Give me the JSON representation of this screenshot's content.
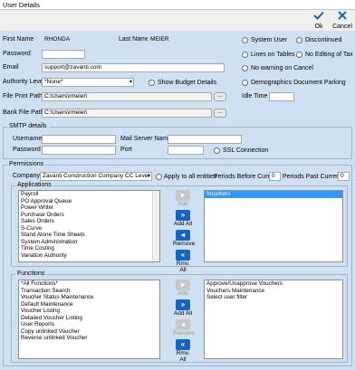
{
  "window": {
    "title": "User Details"
  },
  "toolbar": {
    "ok_label": "Ok",
    "cancel_label": "Cancel"
  },
  "user": {
    "first_name_label": "First Name",
    "first_name": "RHONDA",
    "last_name_label": "Last Name",
    "last_name": "MEIER",
    "password_label": "Password",
    "password": "",
    "email_label": "Email",
    "email": "support@zavanti.com",
    "authority_label": "Authority Level",
    "authority": "*None*",
    "show_budget_label": "Show Budget Details",
    "file_print_label": "File Print Path",
    "file_print_path": "C:\\Users\\rmeier\\",
    "bank_file_label": "Bank File Path",
    "bank_file_path": "C:\\Users\\rmeier\\"
  },
  "options": {
    "system_user": "System User",
    "discontinued": "Discontinued",
    "lines_on_tables": "Lines on Tables",
    "no_editing_tax": "No Editing of Tax",
    "no_warning_cancel": "No warning on Cancel",
    "demographics": "Demographics Document Parking",
    "idle_time_label": "Idle Time",
    "idle_time": ""
  },
  "smtp": {
    "title": "SMTP details",
    "username_label": "Username",
    "username": "",
    "mail_server_label": "Mail Server Name",
    "mail_server": "",
    "password_label": "Password",
    "password": "",
    "port_label": "Port",
    "port": "",
    "ssl_label": "SSL Connection"
  },
  "permissions": {
    "title": "Permissions",
    "company_label": "Company",
    "company": "Zavanti Construction Company CC Level",
    "apply_all_label": "Apply to all entities",
    "periods_before_label": "Periods Before Current",
    "periods_before": "0",
    "periods_past_label": "Periods Past Current",
    "periods_past": "0"
  },
  "applications": {
    "title": "Applications",
    "available": [
      "Payroll",
      "PO Approval Queue",
      "Power Writer",
      "Purchase Orders",
      "Sales Orders",
      "S-Curve",
      "Stand Alone Time Sheets",
      "System Administration",
      "Time Costing",
      "Variation Authority"
    ],
    "selected": [
      "Vouchers"
    ]
  },
  "functions": {
    "title": "Functions",
    "available": [
      "*All Functions*",
      "Transaction Search",
      "Voucher Status Maintenance",
      "Default Maintenance",
      "Voucher Listing",
      "Detailed Voucher Listing",
      "User Reports",
      "Copy unlinked Voucher",
      "Reverse unlinked Voucher"
    ],
    "selected": [
      "Approve/Unapprove Vouchers",
      "Vouchers Maintenance",
      "Select user filter"
    ]
  },
  "move_buttons": {
    "add": "Add",
    "add_all": "Add All",
    "remove": "Remove",
    "remove_all": "Rmv. All"
  },
  "icons": {
    "ok": "check-icon",
    "cancel": "x-icon",
    "browse": "ellipsis-icon"
  },
  "colors": {
    "band": "#cfe0f3",
    "accent": "#1565c0",
    "selection": "#3399ff"
  }
}
